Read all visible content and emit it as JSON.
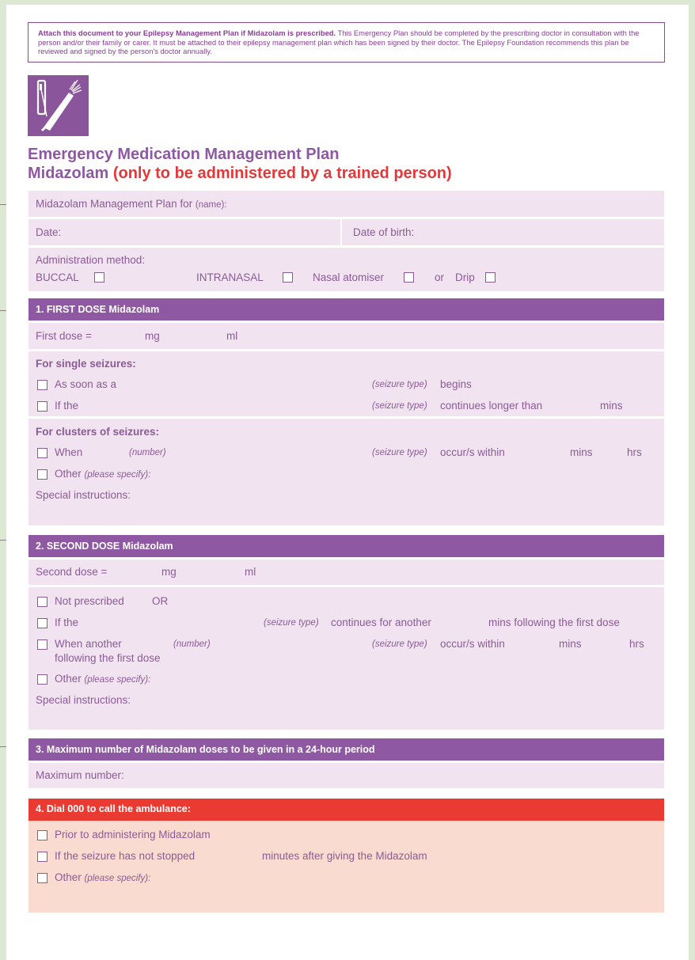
{
  "notice": {
    "bold": "Attach this document to your Epilepsy Management Plan if Midazolam is prescribed.",
    "text": " This Emergency Plan should be completed by the prescribing doctor in consultation with the person and/or their family or carer. It must be attached to their epilepsy management plan which has been signed by their doctor. The Epilepsy Foundation recommends this plan be reviewed and signed by the person's doctor annually."
  },
  "title": {
    "line1": "Emergency Medication Management Plan",
    "line2_main": "Midazolam",
    "line2_warn": "(only to be administered by a trained person)"
  },
  "details": {
    "plan_for": "Midazolam Management Plan for",
    "plan_for_hint": "(name):",
    "date": "Date:",
    "dob": "Date of birth:",
    "admin_method": "Administration method:",
    "buccal": "BUCCAL",
    "intranasal": "INTRANASAL",
    "atomiser": "Nasal atomiser",
    "or": "or",
    "drip": "Drip"
  },
  "first": {
    "header": "1. FIRST DOSE Midazolam",
    "dose": "First dose =",
    "mg": "mg",
    "ml": "ml",
    "single_heading": "For single seizures:",
    "as_soon": "As soon as a",
    "seizure_type": "(seizure type)",
    "begins": "begins",
    "if_the": "If the",
    "continues_longer": "continues longer than",
    "mins": "mins",
    "clusters_heading": "For clusters of seizures:",
    "when": "When",
    "number": "(number)",
    "occurs_within": "occur/s within",
    "hrs": "hrs",
    "other": "Other",
    "please_specify": "(please specify):",
    "special": "Special instructions:"
  },
  "second": {
    "header": "2. SECOND DOSE Midazolam",
    "dose": "Second dose =",
    "mg": "mg",
    "ml": "ml",
    "not_prescribed": "Not prescribed",
    "or": "OR",
    "if_the": "If the",
    "seizure_type": "(seizure type)",
    "continues_another": "continues for another",
    "mins_following": "mins following the first dose",
    "when_another": "When another",
    "number": "(number)",
    "occurs_within": "occur/s within",
    "mins": "mins",
    "hrs": "hrs",
    "following": "following the first dose",
    "other": "Other",
    "please_specify": "(please specify):",
    "special": "Special instructions:"
  },
  "max": {
    "header": "3. Maximum number of Midazolam doses to be given in a 24-hour period",
    "label": "Maximum number:"
  },
  "ambulance": {
    "header": "4. Dial 000 to call the ambulance:",
    "prior": "Prior to administering Midazolam",
    "not_stopped": "If the seizure has not stopped",
    "minutes_after": "minutes after giving the Midazolam",
    "other": "Other",
    "please_specify": "(please specify):"
  }
}
